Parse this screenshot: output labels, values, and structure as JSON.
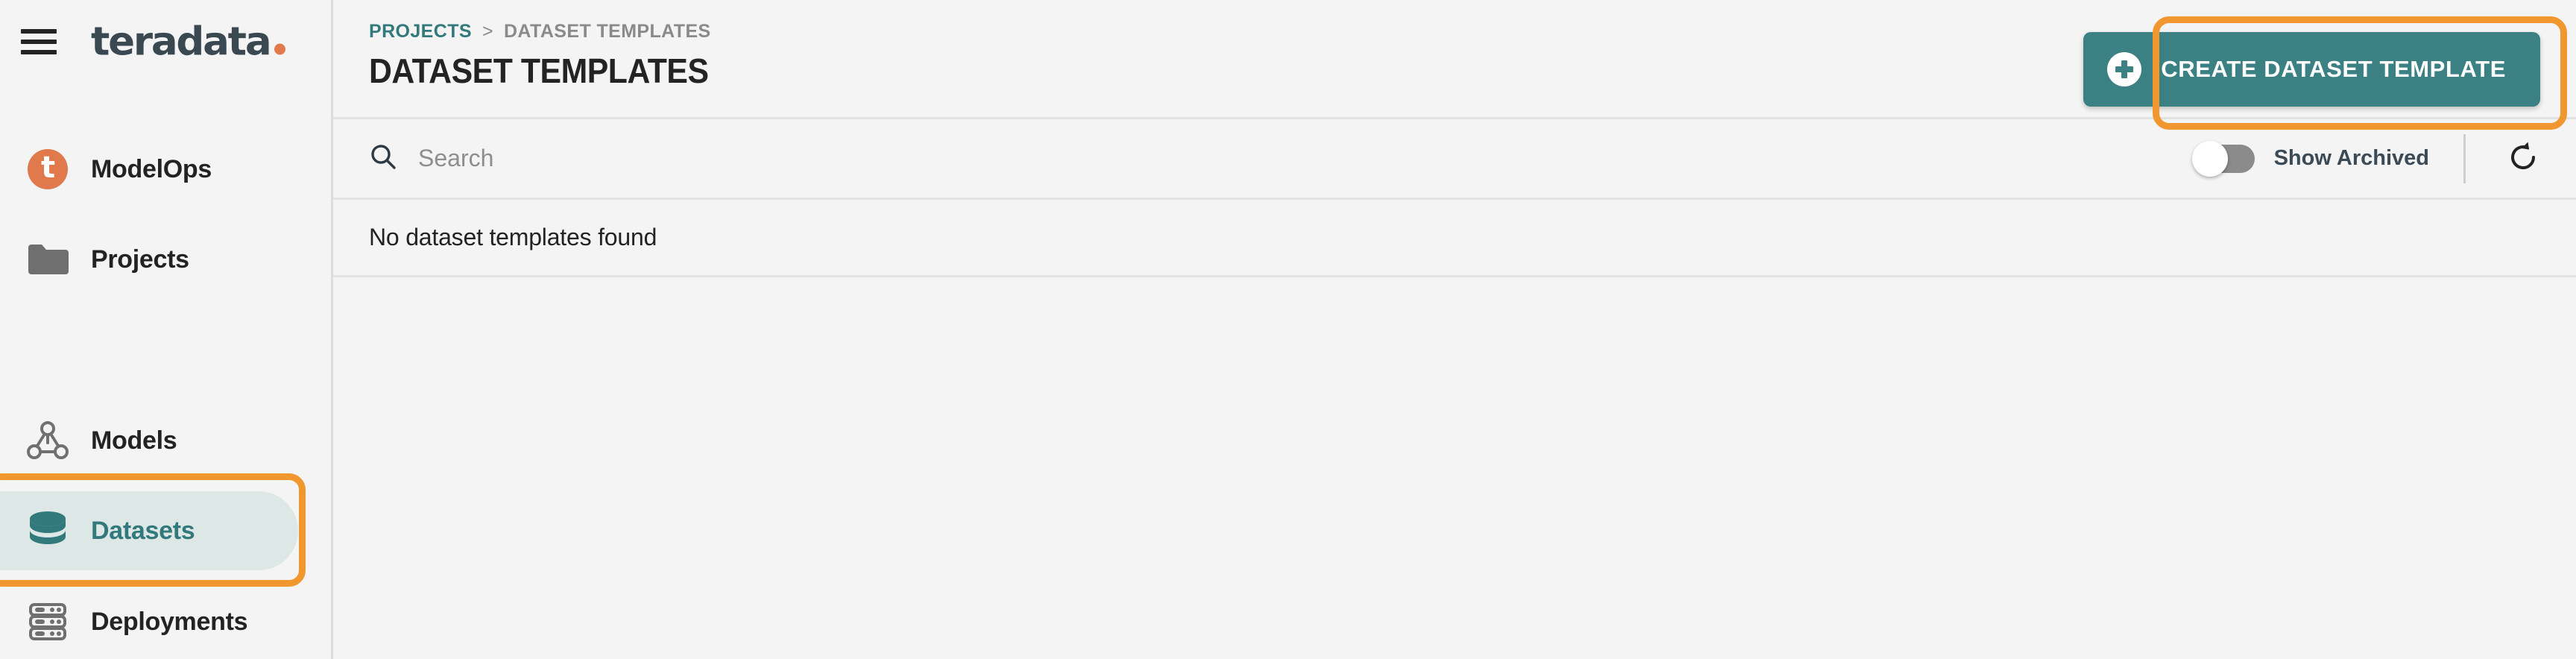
{
  "brand": {
    "logo_text": "teradata",
    "logo_dot_color": "#e07a4d",
    "app_name": "ModelOps"
  },
  "sidebar": {
    "hamburger_name": "menu-icon",
    "items": [
      {
        "id": "modelops",
        "label": "ModelOps",
        "icon": "teradata-t-logo-icon",
        "active": false
      },
      {
        "id": "projects",
        "label": "Projects",
        "icon": "folder-icon",
        "active": false
      },
      {
        "id": "models",
        "label": "Models",
        "icon": "model-graph-icon",
        "active": false
      },
      {
        "id": "datasets",
        "label": "Datasets",
        "icon": "database-icon",
        "active": true
      },
      {
        "id": "deployments",
        "label": "Deployments",
        "icon": "server-rack-icon",
        "active": false
      }
    ],
    "active_text_color": "#32797c",
    "active_bg_color": "#dde7e6"
  },
  "header": {
    "breadcrumb": {
      "parent": "PROJECTS",
      "separator": ">",
      "current": "DATASET TEMPLATES"
    },
    "title": "DATASET TEMPLATES",
    "create_button": {
      "label": "CREATE DATASET TEMPLATE",
      "icon": "plus-circle-icon",
      "background": "#3b8184"
    }
  },
  "filters": {
    "search": {
      "placeholder": "Search",
      "value": "",
      "icon": "search-icon"
    },
    "show_archived": {
      "label": "Show Archived",
      "enabled": false
    },
    "refresh": {
      "icon": "refresh-icon",
      "tooltip": "Refresh"
    }
  },
  "content": {
    "empty_message": "No dataset templates found",
    "rows": []
  },
  "annotations": {
    "color": "#f0972f",
    "boxes": [
      {
        "id": "datasets-nav-highlight",
        "target": "sidebar-item-datasets"
      },
      {
        "id": "create-button-highlight",
        "target": "create-dataset-template-button"
      }
    ]
  }
}
